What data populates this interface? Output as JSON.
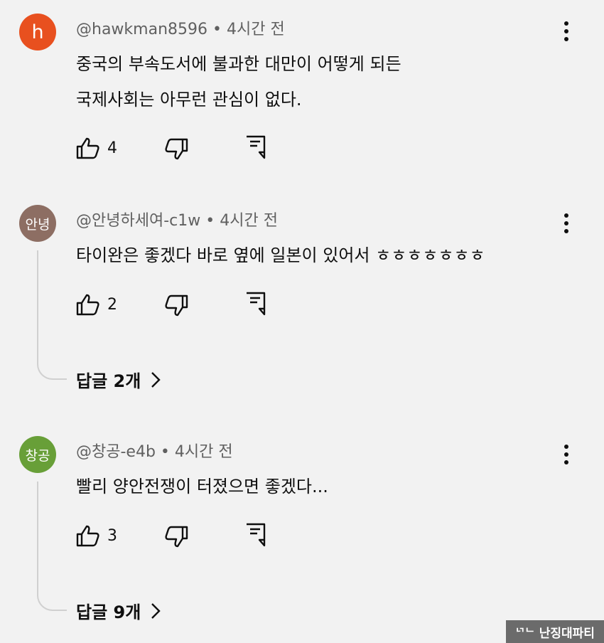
{
  "comments": [
    {
      "avatar_text": "h",
      "avatar_color": "#e8501f",
      "author": "@hawkman8596",
      "separator": "•",
      "time": "4시간 전",
      "lines": [
        "중국의 부속도서에 불과한 대만이 어떻게 되든",
        "국제사회는 아무런 관심이 없다."
      ],
      "likes": "4"
    },
    {
      "avatar_text": "안녕",
      "avatar_color": "#8d6e63",
      "author": "@안녕하세여-c1w",
      "separator": "•",
      "time": "4시간 전",
      "lines": [
        "타이완은 좋겠다  바로 옆에 일본이 있어서 ㅎㅎㅎㅎㅎㅎㅎ"
      ],
      "likes": "2",
      "replies": "답글 2개"
    },
    {
      "avatar_text": "창공",
      "avatar_color": "#689f38",
      "author": "@창공-e4b",
      "separator": "•",
      "time": "4시간 전",
      "lines": [
        "빨리 양안전쟁이 터졌으면 좋겠다..."
      ],
      "likes": "3",
      "replies": "답글 9개"
    }
  ],
  "icons": {
    "like": "thumbs-up-icon",
    "dislike": "thumbs-down-icon",
    "reply": "comment-reply-icon",
    "more": "more-vert-icon",
    "chevron": "chevron-right-icon"
  },
  "watermark": {
    "logo": "ᄓᄂ",
    "text": "난징대파티"
  }
}
